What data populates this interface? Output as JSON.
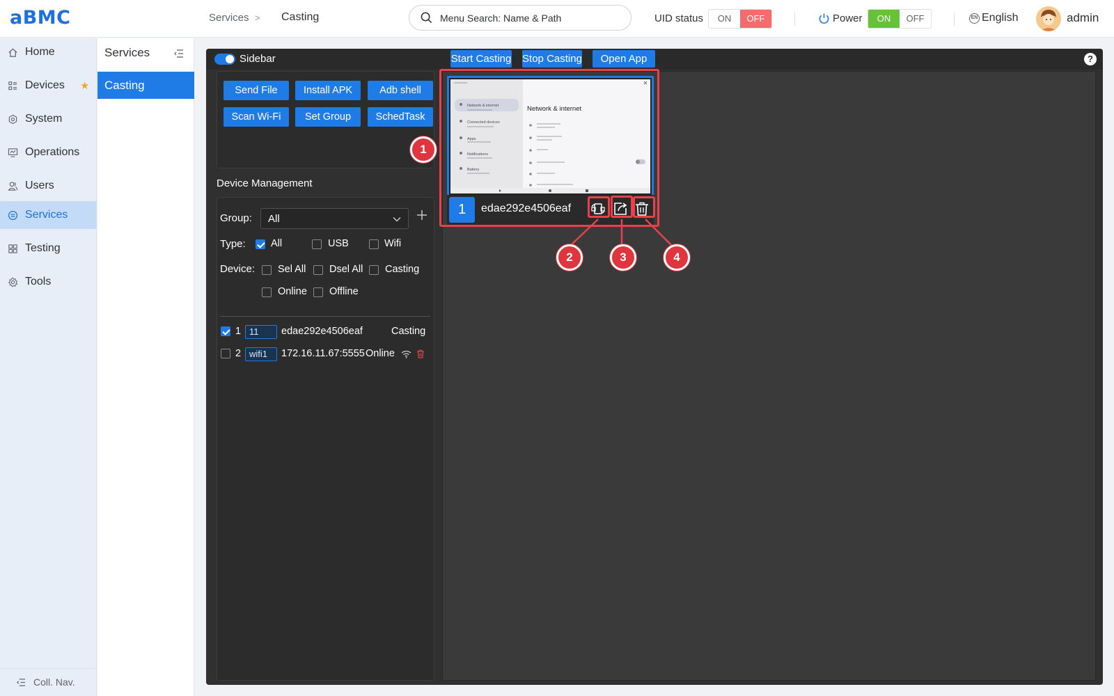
{
  "app": {
    "logo": "aBMC"
  },
  "header": {
    "breadcrumb": [
      "Services",
      "Casting"
    ],
    "breadcrumb_sep": ">",
    "search_placeholder": "Menu Search: Name & Path",
    "uid_status_label": "UID status",
    "uid_on": "ON",
    "uid_off": "OFF",
    "power_label": "Power",
    "power_on": "ON",
    "power_off": "OFF",
    "language": "English",
    "language_badge": "EN",
    "user": "admin"
  },
  "leftnav": {
    "items": [
      {
        "label": "Home",
        "icon": "home-icon"
      },
      {
        "label": "Devices",
        "icon": "devices-icon"
      },
      {
        "label": "System",
        "icon": "system-icon"
      },
      {
        "label": "Operations",
        "icon": "operations-icon"
      },
      {
        "label": "Users",
        "icon": "users-icon"
      },
      {
        "label": "Services",
        "icon": "services-icon",
        "active": true
      },
      {
        "label": "Testing",
        "icon": "testing-icon"
      },
      {
        "label": "Tools",
        "icon": "tools-icon"
      }
    ],
    "collapse_label": "Coll. Nav."
  },
  "subnav": {
    "title": "Services",
    "items": [
      {
        "label": "Casting",
        "active": true
      }
    ]
  },
  "toolbar": {
    "sidebar_label": "Sidebar",
    "sidebar_toggle": true,
    "buttons": [
      "Start Casting",
      "Stop Casting",
      "Open App"
    ],
    "help": "?"
  },
  "actions": [
    "Send File",
    "Install APK",
    "Adb shell",
    "Scan Wi-Fi",
    "Set Group",
    "SchedTask"
  ],
  "device_management": {
    "title": "Device Management",
    "group_label": "Group:",
    "group_value": "All",
    "type_label": "Type:",
    "types": [
      {
        "label": "All",
        "checked": true
      },
      {
        "label": "USB",
        "checked": false
      },
      {
        "label": "Wifi",
        "checked": false
      }
    ],
    "device_label": "Device:",
    "device_filters": [
      {
        "label": "Sel All",
        "checked": false
      },
      {
        "label": "Dsel All",
        "checked": false
      },
      {
        "label": "Casting",
        "checked": false
      },
      {
        "label": "Online",
        "checked": false
      },
      {
        "label": "Offline",
        "checked": false
      }
    ],
    "devices": [
      {
        "index": "1",
        "tag": "11",
        "name": "edae292e4506eaf",
        "status": "Casting",
        "checked": true
      },
      {
        "index": "2",
        "tag": "wifi1",
        "name": "172.16.11.67:5555",
        "status": "Online",
        "checked": false
      }
    ]
  },
  "cast_card": {
    "number": "1",
    "device_id": "edae292e4506eaf",
    "icons": [
      "rotate-icon",
      "share-icon",
      "delete-icon"
    ],
    "screen": {
      "heading": "Network & internet",
      "menu": [
        "Network & internet",
        "Connected devices",
        "Apps",
        "Notifications",
        "Battery"
      ]
    }
  },
  "annotations": [
    "1",
    "2",
    "3",
    "4"
  ],
  "colors": {
    "accent": "#1f7ce6",
    "danger": "#e8414b",
    "success": "#67c23a",
    "logo": "#1f6fe0"
  }
}
